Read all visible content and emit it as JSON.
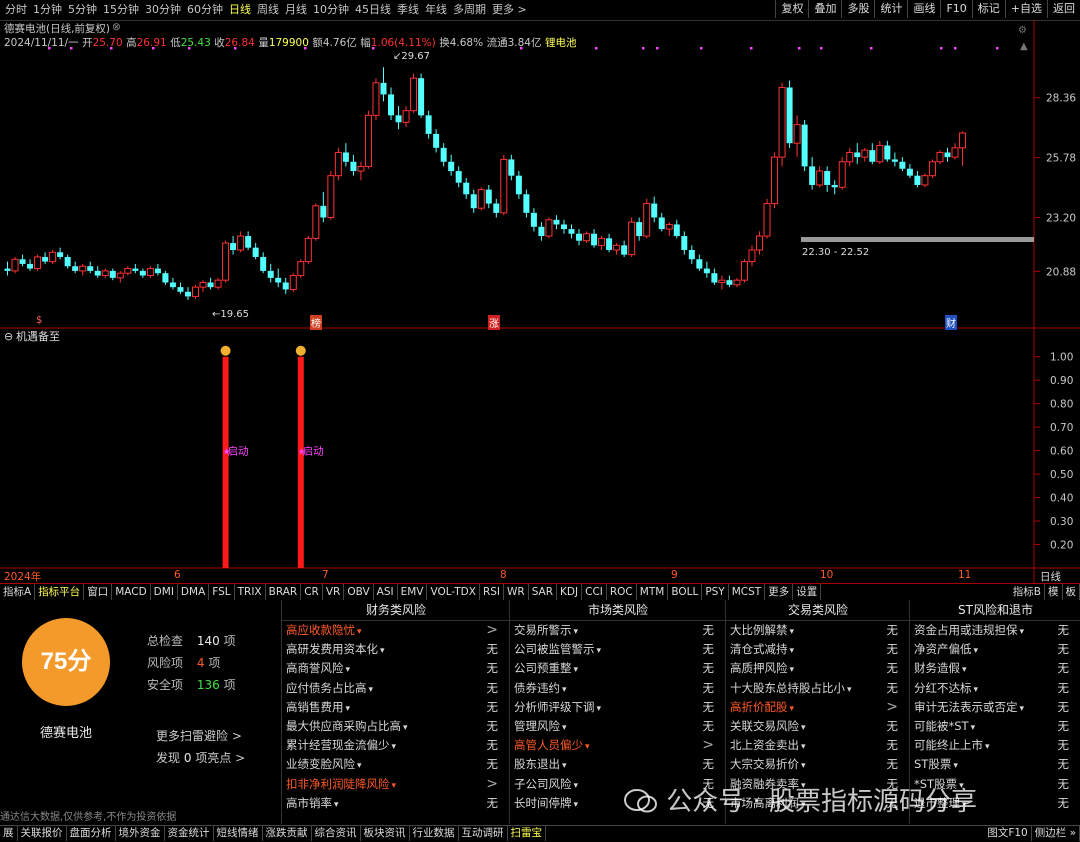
{
  "top_periods": [
    "分时",
    "1分钟",
    "5分钟",
    "15分钟",
    "30分钟",
    "60分钟",
    "日线",
    "周线",
    "月线",
    "10分钟",
    "45日线",
    "季线",
    "年线",
    "多周期",
    "更多 >"
  ],
  "active_period": "日线",
  "right_tools": [
    "复权",
    "叠加",
    "多股",
    "统计",
    "画线",
    "F10",
    "标记",
    "+自选",
    "返回"
  ],
  "title_line": "德赛电池(日线,前复权)",
  "info": {
    "date": "2024/11/11/一",
    "open_label": "开",
    "open": "25.70",
    "high_label": "高",
    "high": "26.91",
    "low_label": "低",
    "low": "25.43",
    "close_label": "收",
    "close": "26.84",
    "vol_label": "量",
    "vol": "179900",
    "amount_label": "额",
    "amount": "4.76亿",
    "change_label": "幅",
    "change": "1.06(4.11%)",
    "turnover_label": "换",
    "turnover": "4.68%",
    "float_label": "流通",
    "float": "3.84亿",
    "sector": "锂电池"
  },
  "price_ticks": [
    "28.36",
    "25.78",
    "23.20",
    "20.88"
  ],
  "annotations": {
    "high": "29.67",
    "low": "19.65",
    "range": "22.30 - 22.52"
  },
  "event_marks": [
    "$",
    "榜",
    "涨",
    "财"
  ],
  "indicator_title": "机遇备至",
  "indicator_ticks": [
    "1.00",
    "0.90",
    "0.80",
    "0.70",
    "0.60",
    "0.50",
    "0.40",
    "0.30",
    "0.20"
  ],
  "indicator_label": "启动",
  "date_axis": [
    "2024年",
    "6",
    "7",
    "8",
    "9",
    "10",
    "11",
    "日线"
  ],
  "toolbar": [
    "指标A",
    "指标平台",
    "窗口",
    "MACD",
    "DMI",
    "DMA",
    "FSL",
    "TRIX",
    "BRAR",
    "CR",
    "VR",
    "OBV",
    "ASI",
    "EMV",
    "VOL-TDX",
    "RSI",
    "WR",
    "SAR",
    "KDJ",
    "CCI",
    "ROC",
    "MTM",
    "BOLL",
    "PSY",
    "MCST",
    "更多",
    "设置"
  ],
  "toolbar_right": [
    "指标B",
    "模",
    "板"
  ],
  "score": {
    "value": "75分",
    "name": "德赛电池",
    "total_label": "总检查",
    "total": "140",
    "total_unit": "项",
    "risk_label": "风险项",
    "risk": "4",
    "risk_unit": "项",
    "safe_label": "安全项",
    "safe": "136",
    "safe_unit": "项",
    "more": "更多扫雷避险 >",
    "highlight_pre": "发现",
    "highlight_count": "0",
    "highlight_post": "项亮点 >",
    "disclaimer": "通达信大数据,仅供参考,不作为投资依据"
  },
  "columns": [
    {
      "title": "财务类风险",
      "rows": [
        {
          "label": "高应收款隐忧",
          "value": ">",
          "warn": true
        },
        {
          "label": "高研发费用资本化",
          "value": "无"
        },
        {
          "label": "高商誉风险",
          "value": "无"
        },
        {
          "label": "应付债务占比高",
          "value": "无"
        },
        {
          "label": "高销售费用",
          "value": "无"
        },
        {
          "label": "最大供应商采购占比高",
          "value": "无"
        },
        {
          "label": "累计经营现金流偏少",
          "value": "无"
        },
        {
          "label": "业绩变脸风险",
          "value": "无"
        },
        {
          "label": "扣非净利润陡降风险",
          "value": ">",
          "warn": true
        },
        {
          "label": "高市销率",
          "value": "无"
        }
      ]
    },
    {
      "title": "市场类风险",
      "rows": [
        {
          "label": "交易所警示",
          "value": "无"
        },
        {
          "label": "公司被监管警示",
          "value": "无"
        },
        {
          "label": "公司预重整",
          "value": "无"
        },
        {
          "label": "债券违约",
          "value": "无"
        },
        {
          "label": "分析师评级下调",
          "value": "无"
        },
        {
          "label": "管理风险",
          "value": "无"
        },
        {
          "label": "高管人员偏少",
          "value": ">",
          "warn": true
        },
        {
          "label": "股东退出",
          "value": "无"
        },
        {
          "label": "子公司风险",
          "value": "无"
        },
        {
          "label": "长时间停牌",
          "value": "无"
        }
      ]
    },
    {
      "title": "交易类风险",
      "rows": [
        {
          "label": "大比例解禁",
          "value": "无"
        },
        {
          "label": "清仓式减持",
          "value": "无"
        },
        {
          "label": "高质押风险",
          "value": "无"
        },
        {
          "label": "十大股东总持股占比小",
          "value": "无"
        },
        {
          "label": "高折价配股",
          "value": ">",
          "warn": true
        },
        {
          "label": "关联交易风险",
          "value": "无"
        },
        {
          "label": "北上资金卖出",
          "value": "无"
        },
        {
          "label": "大宗交易折价",
          "value": "无"
        },
        {
          "label": "融资融券卖率",
          "value": "无"
        },
        {
          "label": "市场高离利润",
          "value": "无"
        }
      ]
    },
    {
      "title": "ST风险和退市",
      "rows": [
        {
          "label": "资金占用或违规担保",
          "value": "无"
        },
        {
          "label": "净资产偏低",
          "value": "无"
        },
        {
          "label": "财务造假",
          "value": "无"
        },
        {
          "label": "分红不达标",
          "value": "无"
        },
        {
          "label": "审计无法表示或否定",
          "value": "无"
        },
        {
          "label": "可能被*ST",
          "value": "无"
        },
        {
          "label": "可能终止上市",
          "value": "无"
        },
        {
          "label": "ST股票",
          "value": "无"
        },
        {
          "label": "*ST股票",
          "value": "无"
        },
        {
          "label": "退市整理",
          "value": "无"
        }
      ]
    }
  ],
  "bottom_bar": [
    "展",
    "关联报价",
    "盘面分析",
    "境外资金",
    "资金统计",
    "短线情绪",
    "涨跌贡献",
    "综合资讯",
    "板块资讯",
    "行业数据",
    "互动调研",
    "扫雷宝"
  ],
  "bottom_right": [
    "图文F10",
    "侧边栏 »"
  ],
  "watermark": "公众号 · 股票指标源码分享",
  "colors": {
    "up": "#ff3232",
    "down": "#54ffff",
    "accent": "#ffff55",
    "signal": "#ff1a1a",
    "score": "#f39a2a",
    "magenta": "#ff44ff"
  },
  "chart_data": {
    "type": "candlestick",
    "x_axis_ticks": [
      "2024年",
      "6",
      "7",
      "8",
      "9",
      "10",
      "11"
    ],
    "y_ticks": [
      28.36,
      25.78,
      23.2,
      20.88
    ],
    "ylim": [
      19.0,
      30.5
    ],
    "candles": [
      [
        21.0,
        21.3,
        20.7,
        20.9
      ],
      [
        20.9,
        21.5,
        20.8,
        21.4
      ],
      [
        21.4,
        21.6,
        21.1,
        21.2
      ],
      [
        21.2,
        21.4,
        20.9,
        21.0
      ],
      [
        21.0,
        21.6,
        20.9,
        21.5
      ],
      [
        21.5,
        21.7,
        21.2,
        21.3
      ],
      [
        21.3,
        21.8,
        21.2,
        21.7
      ],
      [
        21.7,
        21.9,
        21.4,
        21.5
      ],
      [
        21.5,
        21.6,
        21.0,
        21.1
      ],
      [
        21.1,
        21.3,
        20.8,
        20.9
      ],
      [
        20.9,
        21.2,
        20.7,
        21.1
      ],
      [
        21.1,
        21.3,
        20.8,
        20.9
      ],
      [
        20.9,
        21.1,
        20.6,
        20.7
      ],
      [
        20.7,
        21.0,
        20.6,
        20.9
      ],
      [
        20.9,
        21.0,
        20.5,
        20.6
      ],
      [
        20.6,
        20.9,
        20.4,
        20.8
      ],
      [
        20.8,
        21.1,
        20.7,
        21.0
      ],
      [
        21.0,
        21.2,
        20.8,
        20.9
      ],
      [
        20.9,
        21.0,
        20.6,
        20.7
      ],
      [
        20.7,
        21.1,
        20.6,
        21.0
      ],
      [
        21.0,
        21.2,
        20.7,
        20.8
      ],
      [
        20.8,
        20.9,
        20.3,
        20.4
      ],
      [
        20.4,
        20.6,
        20.1,
        20.2
      ],
      [
        20.2,
        20.4,
        19.9,
        20.0
      ],
      [
        20.0,
        20.2,
        19.65,
        19.8
      ],
      [
        19.8,
        20.3,
        19.7,
        20.2
      ],
      [
        20.2,
        20.5,
        20.0,
        20.4
      ],
      [
        20.4,
        20.6,
        20.1,
        20.2
      ],
      [
        20.2,
        20.6,
        20.1,
        20.5
      ],
      [
        20.5,
        22.2,
        20.4,
        22.1
      ],
      [
        22.1,
        22.4,
        21.6,
        21.8
      ],
      [
        21.8,
        22.6,
        21.7,
        22.4
      ],
      [
        22.4,
        22.6,
        21.8,
        21.9
      ],
      [
        21.9,
        22.1,
        21.4,
        21.5
      ],
      [
        21.5,
        21.7,
        20.8,
        20.9
      ],
      [
        20.9,
        21.2,
        20.4,
        20.6
      ],
      [
        20.6,
        21.0,
        20.2,
        20.4
      ],
      [
        20.4,
        20.6,
        19.9,
        20.1
      ],
      [
        20.1,
        20.8,
        20.0,
        20.7
      ],
      [
        20.7,
        21.4,
        20.6,
        21.3
      ],
      [
        21.3,
        22.4,
        21.2,
        22.3
      ],
      [
        22.3,
        23.8,
        22.2,
        23.7
      ],
      [
        23.7,
        24.3,
        23.0,
        23.2
      ],
      [
        23.2,
        25.2,
        23.1,
        25.0
      ],
      [
        25.0,
        26.2,
        24.8,
        26.0
      ],
      [
        26.0,
        26.4,
        25.4,
        25.6
      ],
      [
        25.6,
        25.9,
        25.0,
        25.2
      ],
      [
        25.2,
        25.6,
        24.8,
        25.4
      ],
      [
        25.4,
        27.8,
        25.3,
        27.6
      ],
      [
        27.6,
        29.2,
        27.4,
        29.0
      ],
      [
        29.0,
        29.67,
        28.2,
        28.5
      ],
      [
        28.5,
        28.8,
        27.4,
        27.6
      ],
      [
        27.6,
        28.0,
        27.0,
        27.3
      ],
      [
        27.3,
        28.0,
        27.1,
        27.8
      ],
      [
        27.8,
        29.4,
        27.7,
        29.2
      ],
      [
        29.2,
        29.4,
        27.5,
        27.6
      ],
      [
        27.6,
        27.8,
        26.6,
        26.8
      ],
      [
        26.8,
        27.0,
        26.0,
        26.2
      ],
      [
        26.2,
        26.4,
        25.4,
        25.6
      ],
      [
        25.6,
        25.9,
        25.0,
        25.2
      ],
      [
        25.2,
        25.4,
        24.5,
        24.7
      ],
      [
        24.7,
        24.9,
        24.0,
        24.2
      ],
      [
        24.2,
        24.4,
        23.4,
        23.6
      ],
      [
        23.6,
        24.5,
        23.5,
        24.4
      ],
      [
        24.4,
        24.6,
        23.6,
        23.8
      ],
      [
        23.8,
        24.0,
        23.2,
        23.4
      ],
      [
        23.4,
        25.9,
        23.3,
        25.7
      ],
      [
        25.7,
        25.9,
        24.8,
        25.0
      ],
      [
        25.0,
        25.2,
        24.0,
        24.2
      ],
      [
        24.2,
        24.4,
        23.2,
        23.4
      ],
      [
        23.4,
        23.6,
        22.6,
        22.8
      ],
      [
        22.8,
        23.0,
        22.2,
        22.4
      ],
      [
        22.4,
        23.2,
        22.3,
        23.1
      ],
      [
        23.1,
        23.3,
        22.7,
        22.9
      ],
      [
        22.9,
        23.1,
        22.5,
        22.7
      ],
      [
        22.7,
        22.9,
        22.3,
        22.5
      ],
      [
        22.5,
        22.7,
        22.0,
        22.2
      ],
      [
        22.2,
        22.6,
        22.1,
        22.5
      ],
      [
        22.5,
        22.7,
        21.9,
        22.0
      ],
      [
        22.0,
        22.4,
        21.8,
        22.3
      ],
      [
        22.3,
        22.5,
        21.7,
        21.8
      ],
      [
        21.8,
        22.1,
        21.6,
        22.0
      ],
      [
        22.0,
        22.2,
        21.5,
        21.6
      ],
      [
        21.6,
        23.2,
        21.5,
        23.0
      ],
      [
        23.0,
        23.2,
        22.2,
        22.4
      ],
      [
        22.4,
        24.0,
        22.3,
        23.8
      ],
      [
        23.8,
        24.1,
        23.0,
        23.2
      ],
      [
        23.2,
        23.4,
        22.6,
        22.7
      ],
      [
        22.7,
        23.0,
        22.4,
        22.9
      ],
      [
        22.9,
        23.1,
        22.3,
        22.4
      ],
      [
        22.4,
        22.6,
        21.6,
        21.8
      ],
      [
        21.8,
        22.0,
        21.2,
        21.4
      ],
      [
        21.4,
        21.6,
        20.9,
        21.0
      ],
      [
        21.0,
        21.3,
        20.6,
        20.8
      ],
      [
        20.8,
        21.0,
        20.3,
        20.4
      ],
      [
        20.4,
        20.7,
        20.1,
        20.5
      ],
      [
        20.5,
        20.7,
        20.2,
        20.3
      ],
      [
        20.3,
        20.6,
        20.2,
        20.5
      ],
      [
        20.5,
        21.4,
        20.4,
        21.3
      ],
      [
        21.3,
        22.0,
        21.1,
        21.8
      ],
      [
        21.8,
        22.6,
        21.6,
        22.4
      ],
      [
        22.4,
        24.0,
        22.3,
        23.8
      ],
      [
        23.8,
        26.0,
        23.6,
        25.8
      ],
      [
        25.8,
        29.0,
        25.4,
        28.8
      ],
      [
        28.8,
        29.1,
        26.2,
        26.4
      ],
      [
        26.4,
        27.6,
        25.8,
        27.2
      ],
      [
        27.2,
        27.4,
        25.2,
        25.4
      ],
      [
        25.4,
        25.8,
        24.4,
        24.6
      ],
      [
        24.6,
        25.4,
        24.5,
        25.2
      ],
      [
        25.2,
        25.4,
        24.3,
        24.6
      ],
      [
        24.6,
        24.8,
        24.2,
        24.5
      ],
      [
        24.5,
        25.8,
        24.4,
        25.6
      ],
      [
        25.6,
        26.2,
        25.4,
        26.0
      ],
      [
        26.0,
        26.4,
        25.5,
        25.8
      ],
      [
        25.8,
        26.2,
        25.6,
        26.1
      ],
      [
        26.1,
        26.4,
        25.5,
        25.6
      ],
      [
        25.6,
        26.5,
        25.5,
        26.3
      ],
      [
        26.3,
        26.5,
        25.6,
        25.7
      ],
      [
        25.7,
        26.0,
        25.4,
        25.6
      ],
      [
        25.6,
        25.8,
        25.2,
        25.3
      ],
      [
        25.3,
        25.5,
        24.9,
        25.0
      ],
      [
        25.0,
        25.2,
        24.5,
        24.6
      ],
      [
        24.6,
        25.1,
        24.5,
        25.0
      ],
      [
        25.0,
        25.7,
        24.9,
        25.6
      ],
      [
        25.6,
        26.1,
        25.5,
        26.0
      ],
      [
        26.0,
        26.2,
        25.6,
        25.8
      ],
      [
        25.8,
        26.4,
        25.7,
        26.2
      ],
      [
        26.2,
        26.91,
        25.43,
        26.84
      ]
    ],
    "signals": [
      {
        "index": 29,
        "value": 1.0,
        "label": "启动"
      },
      {
        "index": 39,
        "value": 1.0,
        "label": "启动"
      }
    ],
    "indicator_ylim": [
      0.1,
      1.05
    ]
  }
}
